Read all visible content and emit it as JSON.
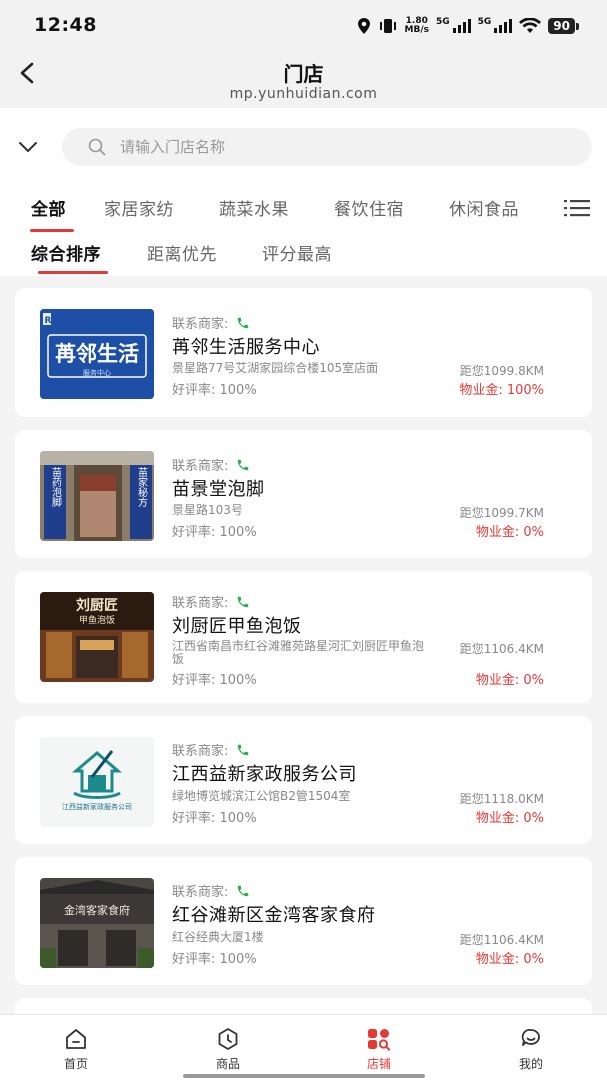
{
  "status_bar": {
    "time": "12:48",
    "net_speed_top": "1.80",
    "net_speed_bottom": "MB/s",
    "signal1": "5G",
    "signal2": "5G",
    "battery": "90"
  },
  "header": {
    "title": "门店",
    "url": "mp.yunhuidian.com"
  },
  "search": {
    "placeholder": "请输入门店名称"
  },
  "category_tabs": [
    "全部",
    "家居家纺",
    "蔬菜水果",
    "餐饮住宿",
    "休闲食品"
  ],
  "sort_tabs": [
    "综合排序",
    "距离优先",
    "评分最高"
  ],
  "stores": [
    {
      "contact_label": "联系商家:",
      "name": "苒邻生活服务中心",
      "address": "景星路77号艾湖家园综合楼105室店面",
      "distance": "距您1099.8KM",
      "rating": "好评率: 100%",
      "fee": "物业金: 100%",
      "thumb_text": "苒邻生活",
      "thumb_sub": "服务中心",
      "thumb_corner": "R"
    },
    {
      "contact_label": "联系商家:",
      "name": "苗景堂泡脚",
      "address": "景星路103号",
      "distance": "距您1099.7KM",
      "rating": "好评率: 100%",
      "fee": "物业金: 0%",
      "thumb_left": "苗药泡脚",
      "thumb_right": "苗家秘方"
    },
    {
      "contact_label": "联系商家:",
      "name": "刘厨匠甲鱼泡饭",
      "address": "江西省南昌市红谷滩雅苑路星河汇刘厨匠甲鱼泡饭",
      "distance": "距您1106.4KM",
      "rating": "好评率: 100%",
      "fee": "物业金: 0%",
      "thumb_sign": "刘厨匠",
      "thumb_sign2": "甲鱼泡饭"
    },
    {
      "contact_label": "联系商家:",
      "name": "江西益新家政服务公司",
      "address": "绿地博览城滨江公馆B2管1504室",
      "distance": "距您1118.0KM",
      "rating": "好评率: 100%",
      "fee": "物业金: 0%",
      "thumb_logo_text": "江西益新家政服务公司"
    },
    {
      "contact_label": "联系商家:",
      "name": "红谷滩新区金湾客家食府",
      "address": "红谷经典大厦1楼",
      "distance": "距您1106.4KM",
      "rating": "好评率: 100%",
      "fee": "物业金: 0%",
      "thumb_sign": "金湾客家食府"
    }
  ],
  "bottom_nav": [
    {
      "label": "首页",
      "icon": "home-icon"
    },
    {
      "label": "商品",
      "icon": "goods-icon"
    },
    {
      "label": "店铺",
      "icon": "store-icon"
    },
    {
      "label": "我的",
      "icon": "profile-icon"
    }
  ],
  "colors": {
    "accent": "#e53935",
    "phone_green": "#2bb24c",
    "nav_active": "#e53935"
  }
}
